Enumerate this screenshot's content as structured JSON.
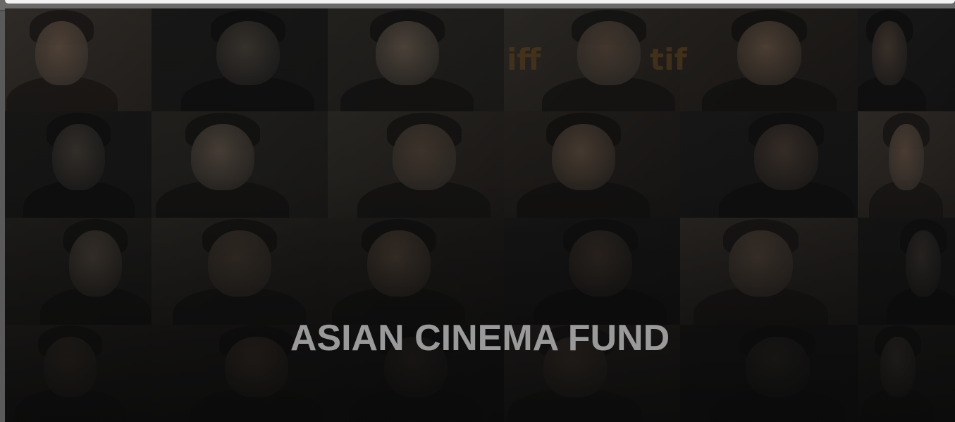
{
  "hero": {
    "title": "ASIAN CINEMA FUND",
    "watermark_left": "iff",
    "watermark_right": "tif"
  },
  "colors": {
    "background": "#0c0c0c",
    "title": "#9a9a9a",
    "frame": "#5a5a5a"
  },
  "portraits": {
    "rows": 4,
    "columns": 6,
    "count": 24
  }
}
